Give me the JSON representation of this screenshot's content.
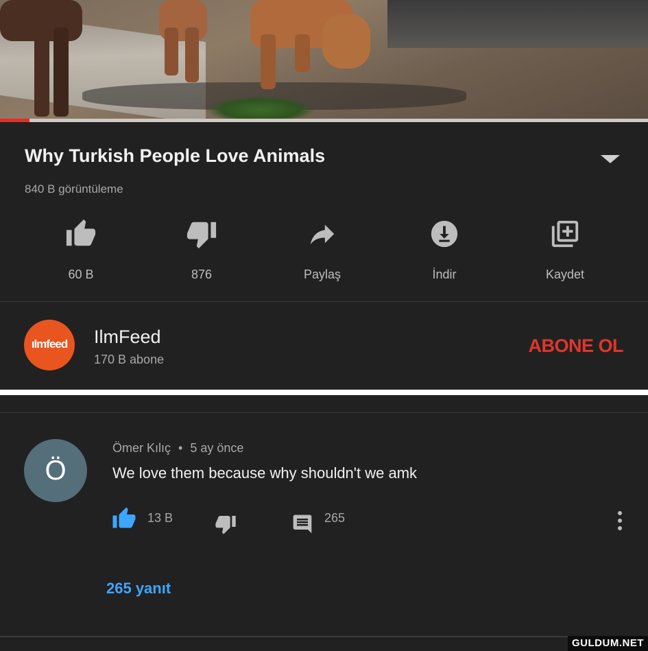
{
  "video": {
    "progress_fraction": 0.045,
    "accent_color": "#e52d27"
  },
  "header": {
    "title": "Why Turkish People Love Animals",
    "views": "840 B görüntüleme"
  },
  "actions": [
    {
      "label": "60 B",
      "icon": "thumb-up-icon"
    },
    {
      "label": "876",
      "icon": "thumb-down-icon"
    },
    {
      "label": "Paylaş",
      "icon": "share-icon"
    },
    {
      "label": "İndir",
      "icon": "download-icon"
    },
    {
      "label": "Kaydet",
      "icon": "playlist-add-icon"
    }
  ],
  "channel": {
    "logo_text": "ılmfeed",
    "logo_color": "#e8551f",
    "name": "IlmFeed",
    "subscribers": "170 B abone",
    "subscribe_label": "ABONE OL",
    "subscribe_color": "#e0362c"
  },
  "comment": {
    "avatar_letter": "Ö",
    "avatar_color": "#546e7a",
    "author": "Ömer Kılıç",
    "separator": "•",
    "time": "5 ay önce",
    "text": "We love them because why shouldn't we amk",
    "likes": "13 B",
    "reply_count": "265",
    "replies_link": "265 yanıt",
    "link_color": "#3ea6ff"
  },
  "watermark": "GULDUM.NET"
}
